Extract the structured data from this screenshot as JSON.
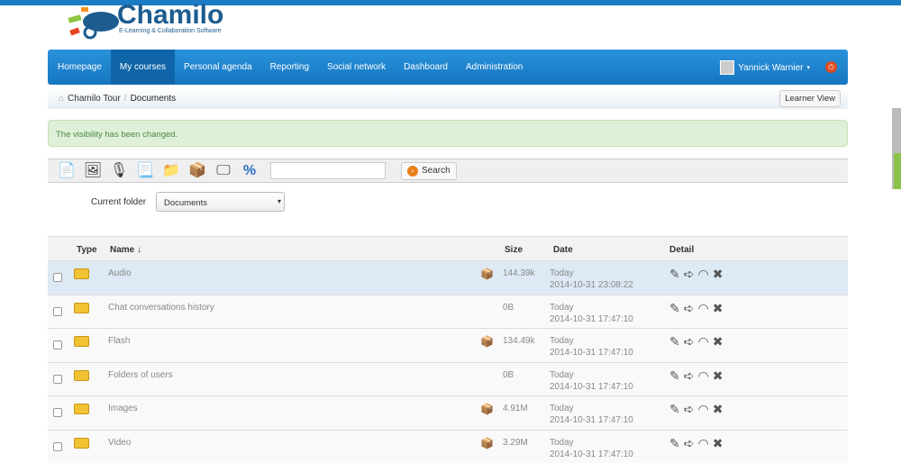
{
  "logo": {
    "name": "Chamilo",
    "tagline": "E-Learning & Collaboration Software"
  },
  "nav": {
    "items": [
      "Homepage",
      "My courses",
      "Personal agenda",
      "Reporting",
      "Social network",
      "Dashboard",
      "Administration"
    ],
    "active": "My courses",
    "user": "Yannick Warnier"
  },
  "breadcrumb": {
    "items": [
      "Chamilo Tour",
      "Documents"
    ],
    "separator": "/",
    "learner_view": "Learner View"
  },
  "alert": "The visibility has been changed.",
  "toolbar": {
    "search_label": "Search",
    "search_value": ""
  },
  "folder": {
    "label": "Current folder",
    "value": "Documents"
  },
  "table": {
    "headers": {
      "type": "Type",
      "name": "Name ↓",
      "size": "Size",
      "date": "Date",
      "detail": "Detail"
    },
    "rows": [
      {
        "name": "Audio",
        "size": "144.39k",
        "day": "Today",
        "date": "2014-10-31 23:08:22"
      },
      {
        "name": "Chat conversations history",
        "size": "0B",
        "day": "Today",
        "date": "2014-10-31 17:47:10"
      },
      {
        "name": "Flash",
        "size": "134.49k",
        "day": "Today",
        "date": "2014-10-31 17:47:10"
      },
      {
        "name": "Folders of users",
        "size": "0B",
        "day": "Today",
        "date": "2014-10-31 17:47:10"
      },
      {
        "name": "Images",
        "size": "4.91M",
        "day": "Today",
        "date": "2014-10-31 17:47:10"
      },
      {
        "name": "Video",
        "size": "3.29M",
        "day": "Today",
        "date": "2014-10-31 17:47:10"
      }
    ]
  }
}
